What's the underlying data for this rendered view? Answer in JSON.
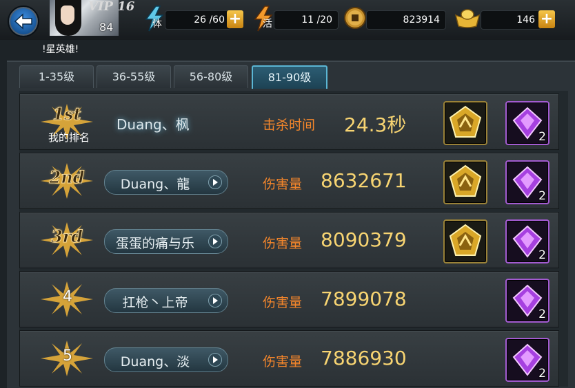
{
  "header": {
    "vip": "VIP 16",
    "level": "84",
    "player_name": "!星英雄!",
    "stamina": {
      "label": "体",
      "value": "26 /60"
    },
    "energy": {
      "label": "活",
      "value": "11 /20"
    },
    "coins": {
      "value": "823914"
    },
    "gold": {
      "value": "146"
    },
    "plus": "+"
  },
  "tabs": [
    {
      "label": "1-35级",
      "active": false
    },
    {
      "label": "36-55级",
      "active": false
    },
    {
      "label": "56-80级",
      "active": false
    },
    {
      "label": "81-90级",
      "active": true
    }
  ],
  "ranking": {
    "my_rank": {
      "rank": "1st",
      "rank_label": "我的排名",
      "player": "Duang、枫",
      "metric_label": "击杀时间",
      "metric_value": "24.3秒",
      "rewards": {
        "gold_count": "",
        "purple_count": "2"
      }
    },
    "rows": [
      {
        "rank": "2nd",
        "player": "Duang、龍",
        "metric_label": "伤害量",
        "metric_value": "8632671",
        "purple_count": "2"
      },
      {
        "rank": "3rd",
        "player": "蛋蛋的痛与乐",
        "metric_label": "伤害量",
        "metric_value": "8090379",
        "purple_count": "2"
      },
      {
        "rank": "4",
        "player": "扛枪丶上帝",
        "metric_label": "伤害量",
        "metric_value": "7899078",
        "purple_count": "2"
      },
      {
        "rank": "5",
        "player": "Duang、淡",
        "metric_label": "伤害量",
        "metric_value": "7886930",
        "purple_count": "2"
      }
    ]
  },
  "colors": {
    "active_tab_border": "#5bb6d4",
    "metric_label": "#f4862b",
    "metric_value": "#f7d472",
    "purple_frame": "#a35bd1",
    "gold_frame": "#9a8238"
  },
  "icons": [
    "back-arrow-icon",
    "stamina-lightning-icon",
    "energy-lightning-icon",
    "coin-icon",
    "gold-ingot-icon",
    "gold-medal-icon",
    "purple-gem-icon",
    "chevron-right-icon"
  ]
}
